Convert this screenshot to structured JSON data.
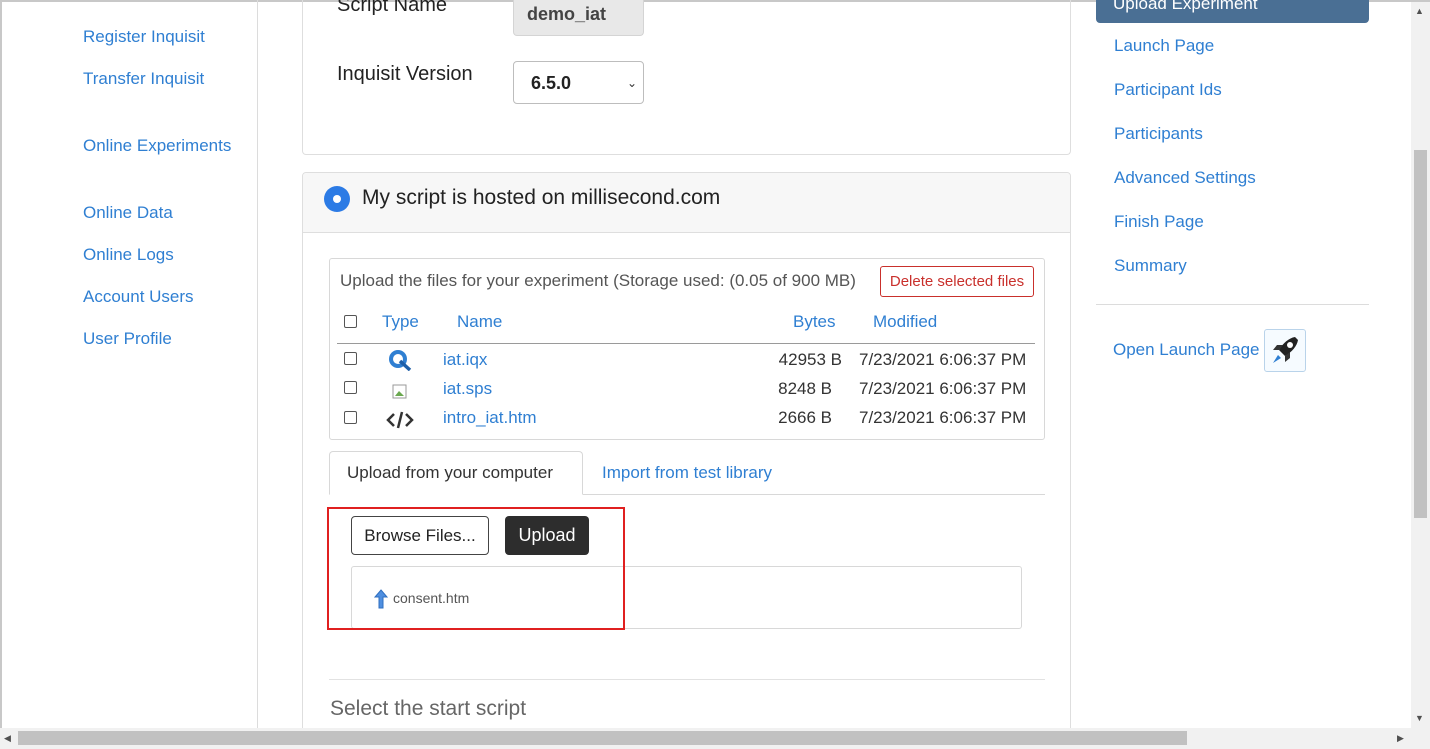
{
  "left_nav": {
    "items": [
      {
        "label": "Register Inquisit"
      },
      {
        "label": "Transfer Inquisit"
      },
      {
        "label": "Online Experiments"
      },
      {
        "label": "Online Data"
      },
      {
        "label": "Online Logs"
      },
      {
        "label": "Account Users"
      },
      {
        "label": "User Profile"
      }
    ]
  },
  "settings": {
    "script_name_label": "Script Name",
    "script_name_value": "demo_iat",
    "version_label": "Inquisit Version",
    "version_selected": "6.5.0"
  },
  "hosting": {
    "option_label": "My script is hosted on millisecond.com",
    "selected": true,
    "storage_text": "Upload the files for your experiment (Storage used: (0.05 of 900 MB)",
    "delete_button": "Delete selected files",
    "columns": [
      "Type",
      "Name",
      "Bytes",
      "Modified"
    ],
    "files": [
      {
        "type_icon": "inquisit-q-icon",
        "name": "iat.iqx",
        "bytes": "42953 B",
        "modified": "7/23/2021 6:06:37 PM"
      },
      {
        "type_icon": "broken-image-icon",
        "name": "iat.sps",
        "bytes": "8248 B",
        "modified": "7/23/2021 6:06:37 PM"
      },
      {
        "type_icon": "code-icon",
        "name": "intro_iat.htm",
        "bytes": "2666 B",
        "modified": "7/23/2021 6:06:37 PM"
      }
    ],
    "tabs": [
      {
        "label": "Upload from your computer",
        "active": true
      },
      {
        "label": "Import from test library",
        "active": false
      }
    ],
    "browse_button": "Browse Files...",
    "upload_button": "Upload",
    "queued_file": "consent.htm",
    "start_script_heading": "Select the start script"
  },
  "right_nav": {
    "active_item": "Upload Experiment",
    "items": [
      {
        "label": "Launch Page"
      },
      {
        "label": "Participant Ids"
      },
      {
        "label": "Participants"
      },
      {
        "label": "Advanced Settings"
      },
      {
        "label": "Finish Page"
      },
      {
        "label": "Summary"
      }
    ],
    "open_launch_label": "Open Launch Page",
    "open_launch_icon": "rocket-icon"
  },
  "colors": {
    "link": "#2f7fd2",
    "radio": "#2c7be5",
    "danger": "#c9302c",
    "active_nav": "#4a6f94",
    "highlight": "#e02020"
  }
}
